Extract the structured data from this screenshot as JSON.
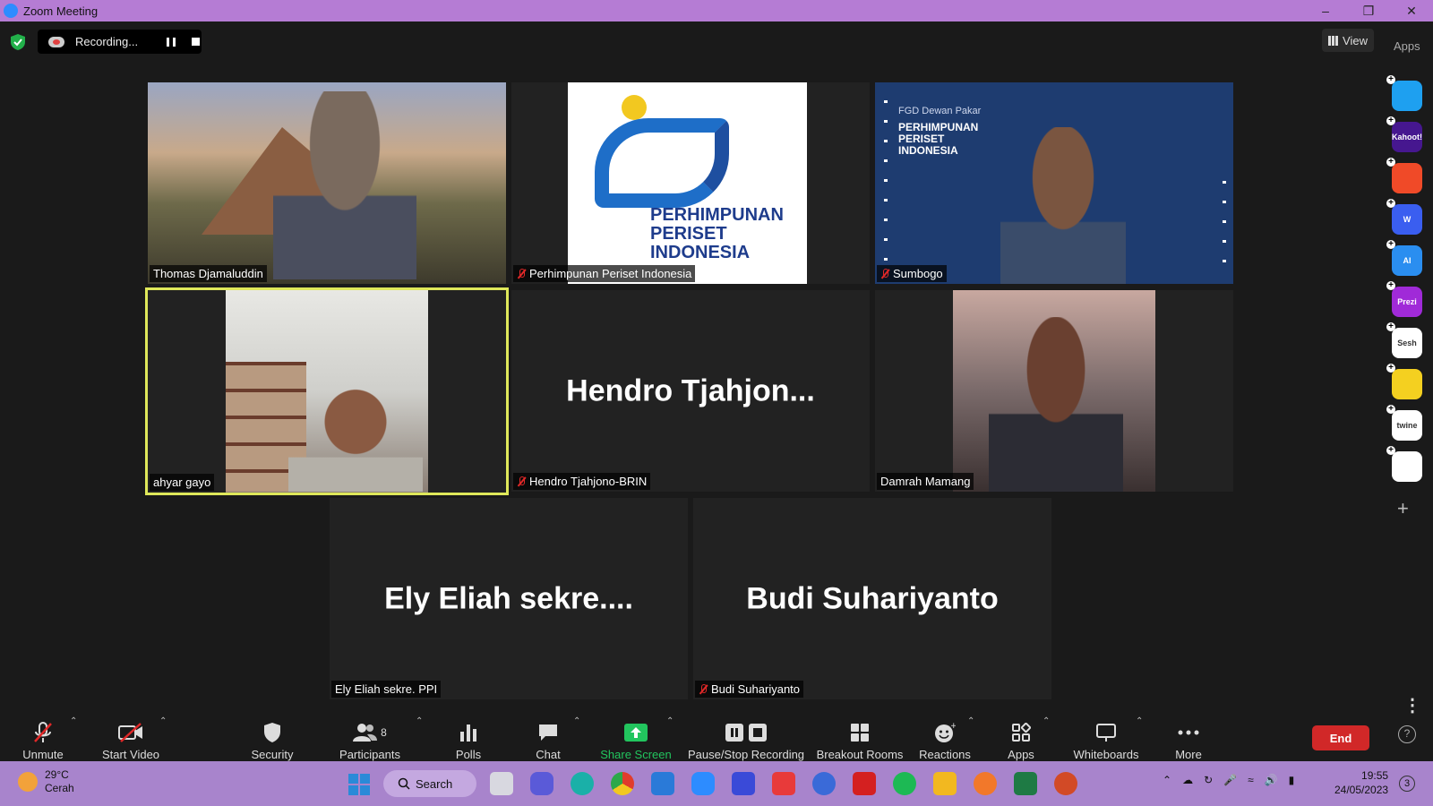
{
  "window": {
    "title": "Zoom Meeting"
  },
  "recording": {
    "label": "Recording..."
  },
  "view_button": {
    "label": "View"
  },
  "apps_label": "Apps",
  "participants_grid": [
    {
      "name": "Thomas Djamaluddin",
      "muted": false,
      "video": true
    },
    {
      "name": "Perhimpunan Periset Indonesia",
      "muted": true,
      "video": true
    },
    {
      "name": "Sumbogo",
      "muted": true,
      "video": true
    },
    {
      "name": "ahyar gayo",
      "muted": false,
      "video": true,
      "active_speaker": true
    },
    {
      "name": "Hendro Tjahjono-BRIN",
      "muted": true,
      "video": false,
      "display_name": "Hendro  Tjahjon..."
    },
    {
      "name": "Damrah Mamang",
      "muted": false,
      "video": true
    },
    {
      "name": "Ely Eliah  sekre.  PPI",
      "muted": false,
      "video": false,
      "display_name": "Ely Eliah   sekre...."
    },
    {
      "name": "Budi Suhariyanto",
      "muted": true,
      "video": false,
      "display_name": "Budi Suhariyanto"
    }
  ],
  "logo_text": {
    "line1": "PERHIMPUNAN",
    "line2": "PERISET",
    "line3": "INDONESIA"
  },
  "slide": {
    "event": "FGD Dewan Pakar",
    "org_line1": "PERHIMPUNAN",
    "org_line2": "PERISET",
    "org_line3": "INDONESIA"
  },
  "side_apps": [
    {
      "name": "pitch-icon",
      "color": "#1ea0f0",
      "label": ""
    },
    {
      "name": "kahoot-icon",
      "color": "#46178f",
      "label": "Kahoot!"
    },
    {
      "name": "app-red-icon",
      "color": "#f04a28",
      "label": ""
    },
    {
      "name": "wooclap-icon",
      "color": "#3a5ef0",
      "label": "W"
    },
    {
      "name": "ai-icon",
      "color": "#2a8ef0",
      "label": "AI"
    },
    {
      "name": "prezi-icon",
      "color": "#a02ad8",
      "label": "Prezi"
    },
    {
      "name": "sesh-icon",
      "color": "#ffffff",
      "label": "Sesh"
    },
    {
      "name": "emoji-app-icon",
      "color": "#f4d020",
      "label": ""
    },
    {
      "name": "twine-icon",
      "color": "#ffffff",
      "label": "twine"
    },
    {
      "name": "blocks-app-icon",
      "color": "#ffffff",
      "label": ""
    }
  ],
  "toolbar": {
    "unmute": "Unmute",
    "start_video": "Start Video",
    "security": "Security",
    "participants": "Participants",
    "participants_count": "8",
    "polls": "Polls",
    "chat": "Chat",
    "share_screen": "Share Screen",
    "pause_stop_recording": "Pause/Stop Recording",
    "breakout_rooms": "Breakout Rooms",
    "reactions": "Reactions",
    "apps": "Apps",
    "whiteboards": "Whiteboards",
    "more": "More",
    "end": "End",
    "share_color": "#22c55e"
  },
  "taskbar": {
    "weather_temp": "29°C",
    "weather_text": "Cerah",
    "search_label": "Search",
    "time": "19:55",
    "date": "24/05/2023",
    "notifications": "3"
  }
}
